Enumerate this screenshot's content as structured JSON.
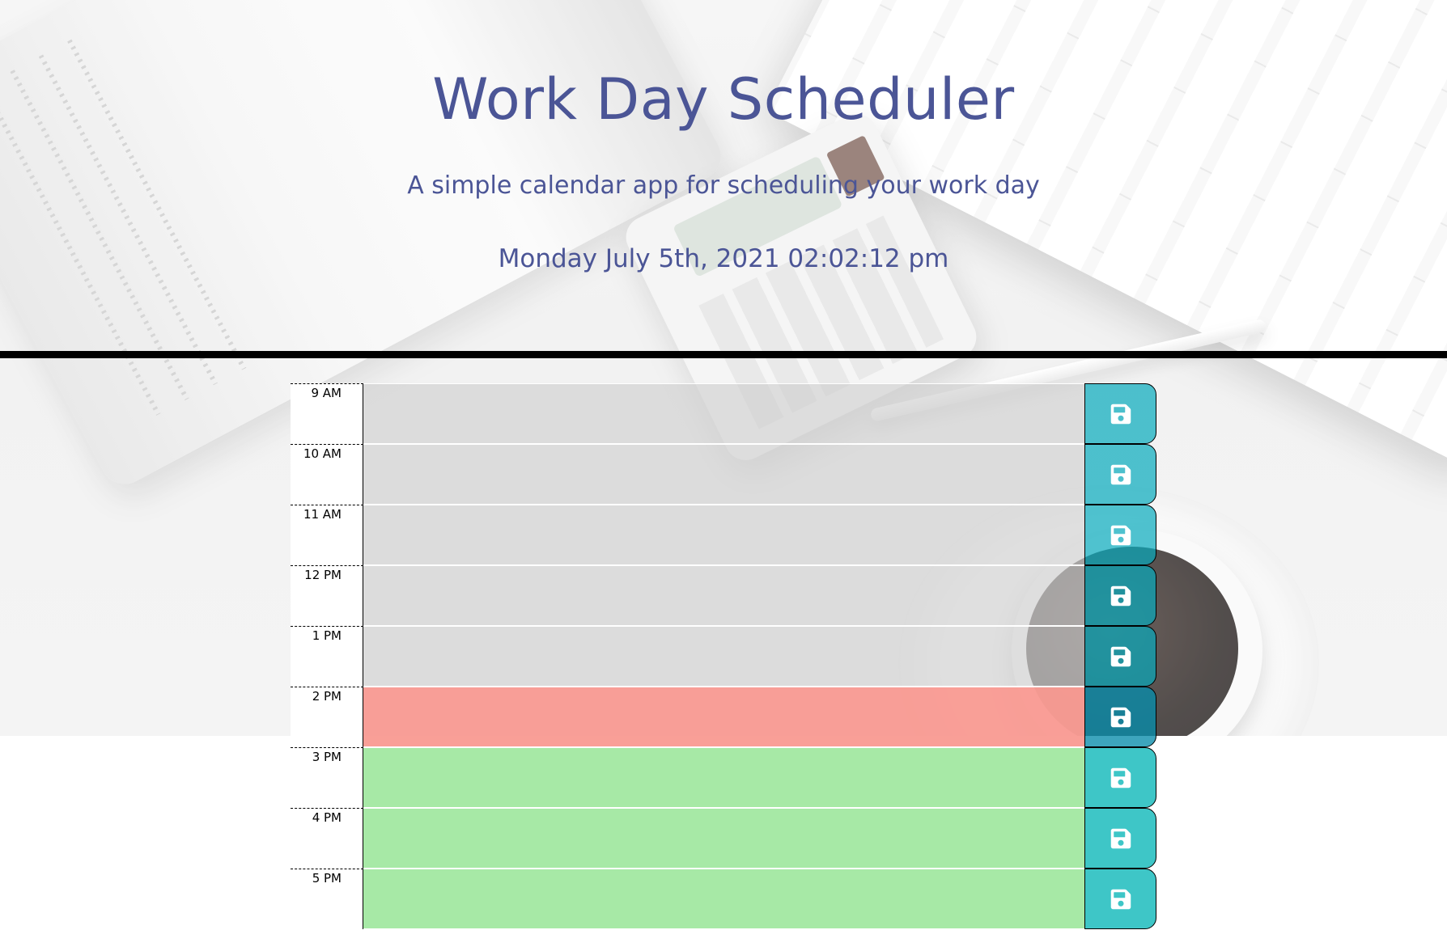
{
  "header": {
    "title": "Work Day Scheduler",
    "lead": "A simple calendar app for scheduling your work day",
    "current_day": "Monday July 5th, 2021 02:02:12 pm"
  },
  "colors": {
    "text_accent": "#4b5596",
    "past": "#d0d0d0",
    "present": "#f99c94",
    "future": "#a7e9a6",
    "save_button": "#06aabc"
  },
  "schedule": {
    "rows": [
      {
        "hour": "9 AM",
        "text": "",
        "state": "past",
        "icon": "floppy-disk-icon"
      },
      {
        "hour": "10 AM",
        "text": "",
        "state": "past",
        "icon": "floppy-disk-icon"
      },
      {
        "hour": "11 AM",
        "text": "",
        "state": "past",
        "icon": "floppy-disk-icon"
      },
      {
        "hour": "12 PM",
        "text": "",
        "state": "past",
        "icon": "floppy-disk-icon"
      },
      {
        "hour": "1 PM",
        "text": "",
        "state": "past",
        "icon": "floppy-disk-icon"
      },
      {
        "hour": "2 PM",
        "text": "",
        "state": "present",
        "icon": "floppy-disk-icon"
      },
      {
        "hour": "3 PM",
        "text": "",
        "state": "future",
        "icon": "floppy-disk-icon"
      },
      {
        "hour": "4 PM",
        "text": "",
        "state": "future",
        "icon": "floppy-disk-icon"
      },
      {
        "hour": "5 PM",
        "text": "",
        "state": "future",
        "icon": "floppy-disk-icon"
      }
    ]
  }
}
